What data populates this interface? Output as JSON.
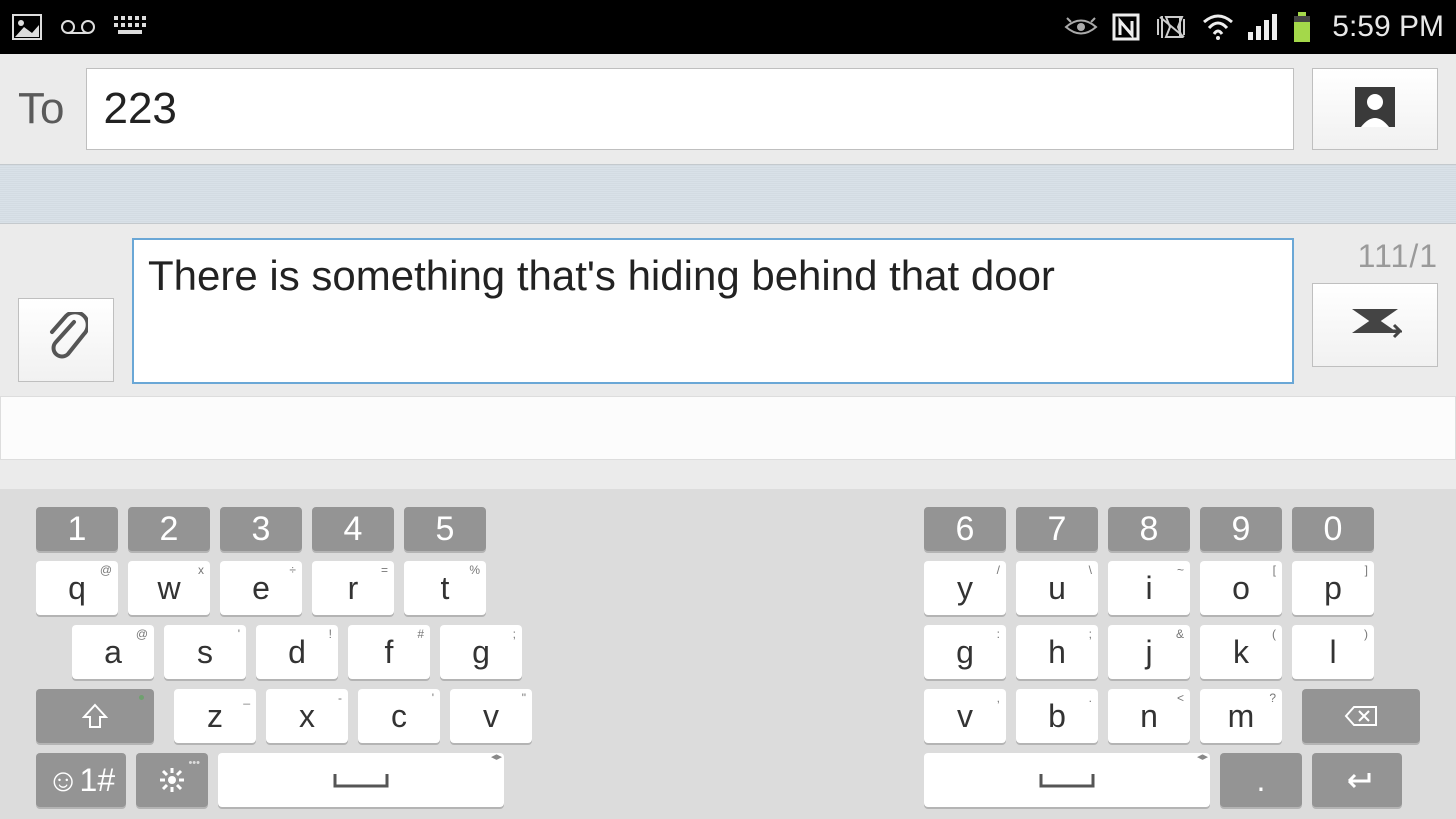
{
  "status": {
    "time": "5:59 PM"
  },
  "compose": {
    "to_label": "To",
    "to_value": "223",
    "message": "There is something that's hiding behind that door",
    "char_count": "111/1"
  },
  "keyboard": {
    "left": {
      "nums": [
        "1",
        "2",
        "3",
        "4",
        "5"
      ],
      "row1": [
        {
          "k": "q",
          "sup": "@"
        },
        {
          "k": "w",
          "sup": "x"
        },
        {
          "k": "e",
          "sup": "÷"
        },
        {
          "k": "r",
          "sup": "="
        },
        {
          "k": "t",
          "sup": "%"
        }
      ],
      "row2": [
        {
          "k": "a",
          "sup": "@"
        },
        {
          "k": "s",
          "sup": "'"
        },
        {
          "k": "d",
          "sup": "!"
        },
        {
          "k": "f",
          "sup": "#"
        },
        {
          "k": "g",
          "sup": ";"
        }
      ],
      "row3": [
        {
          "k": "z",
          "sup": "_"
        },
        {
          "k": "x",
          "sup": "-"
        },
        {
          "k": "c",
          "sup": "'"
        },
        {
          "k": "v",
          "sup": "\""
        }
      ],
      "sym": "☺1#"
    },
    "right": {
      "nums": [
        "6",
        "7",
        "8",
        "9",
        "0"
      ],
      "row1": [
        {
          "k": "y",
          "sup": "/"
        },
        {
          "k": "u",
          "sup": "\\"
        },
        {
          "k": "i",
          "sup": "~"
        },
        {
          "k": "o",
          "sup": "["
        },
        {
          "k": "p",
          "sup": "]"
        }
      ],
      "row2": [
        {
          "k": "g",
          "sup": ":"
        },
        {
          "k": "h",
          "sup": ";"
        },
        {
          "k": "j",
          "sup": "&"
        },
        {
          "k": "k",
          "sup": "("
        },
        {
          "k": "l",
          "sup": ")"
        }
      ],
      "row3": [
        {
          "k": "v",
          "sup": ","
        },
        {
          "k": "b",
          "sup": "."
        },
        {
          "k": "n",
          "sup": "<"
        },
        {
          "k": "m",
          "sup": "?"
        }
      ],
      "period": "."
    }
  }
}
